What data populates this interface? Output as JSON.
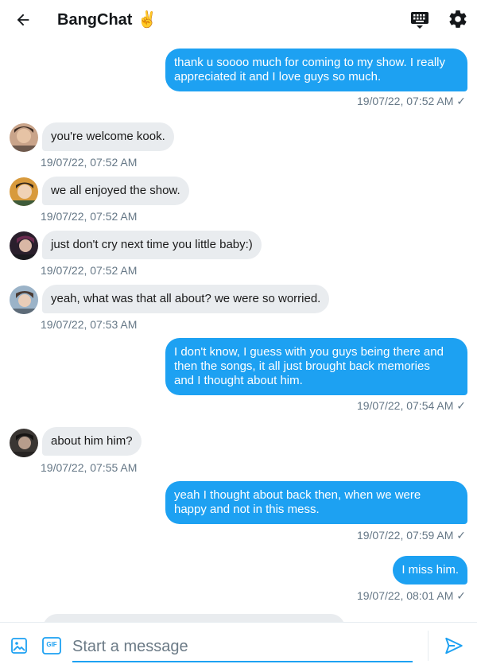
{
  "header": {
    "title": "BangChat",
    "title_emoji": "✌️",
    "back_icon": "arrow-left-icon",
    "keyboard_icon": "keyboard-icon",
    "settings_icon": "gear-icon"
  },
  "colors": {
    "accent": "#1da1f2",
    "incoming_bubble": "#e9ecef",
    "timestamp": "#657786"
  },
  "messages": [
    {
      "direction": "out",
      "text": "thank u soooo much for coming to my show. I really\nappreciated it and I love guys so much.",
      "time": "19/07/22, 07:52 AM ✓"
    },
    {
      "direction": "in",
      "text": "you're welcome kook.",
      "time": "19/07/22, 07:52 AM"
    },
    {
      "direction": "in",
      "text": "we all enjoyed the show.",
      "time": "19/07/22, 07:52 AM"
    },
    {
      "direction": "in",
      "text": "just don't cry next time you little baby:)",
      "time": "19/07/22, 07:52 AM"
    },
    {
      "direction": "in",
      "text": "yeah, what was that all about? we were so worried.",
      "time": "19/07/22, 07:53 AM"
    },
    {
      "direction": "out",
      "text": "I don't know, I guess with you guys being there and\nthen the songs, it all just brought back memories\nand I thought about him.",
      "time": "19/07/22, 07:54 AM ✓"
    },
    {
      "direction": "in",
      "text": "about him him?",
      "time": "19/07/22, 07:55 AM"
    },
    {
      "direction": "out",
      "text": "yeah I thought about back then, when we were\nhappy and not in this mess.",
      "time": "19/07/22, 07:59 AM ✓"
    },
    {
      "direction": "out",
      "text": "I miss him.",
      "time": "19/07/22, 08:01 AM ✓"
    }
  ],
  "composer": {
    "placeholder": "Start a message",
    "image_icon": "image-icon",
    "gif_label": "GIF",
    "send_icon": "send-icon"
  }
}
